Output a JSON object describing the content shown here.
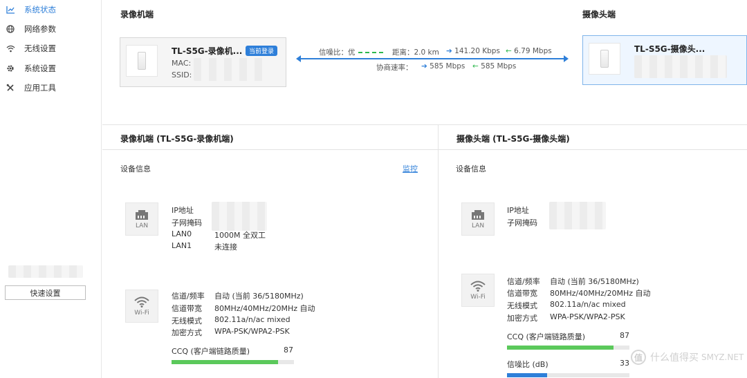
{
  "sidebar": {
    "items": [
      {
        "label": "系统状态",
        "icon": "chart-icon",
        "active": true
      },
      {
        "label": "网络参数",
        "icon": "globe-icon",
        "active": false
      },
      {
        "label": "无线设置",
        "icon": "wifi-icon",
        "active": false
      },
      {
        "label": "系统设置",
        "icon": "gear-icon",
        "active": false
      },
      {
        "label": "应用工具",
        "icon": "tools-icon",
        "active": false
      }
    ],
    "quick_setup": "快速设置"
  },
  "top": {
    "recorder_title": "录像机端",
    "camera_title": "摄像头端",
    "recorder_card": {
      "name": "TL-S5G-录像机...",
      "badge": "当前登录",
      "mac_label": "MAC:",
      "ssid_label": "SSID:"
    },
    "camera_card": {
      "name": "TL-S5G-摄像头..."
    },
    "link": {
      "snr_label": "信噪比：优",
      "distance_label": "距离：2.0 km",
      "tx_rate": "141.20 Kbps",
      "rx_rate": "6.79 Mbps",
      "negotiate_label": "协商速率：",
      "negotiate_tx": "585 Mbps",
      "negotiate_rx": "585 Mbps"
    }
  },
  "left_panel": {
    "title": "录像机端 (TL-S5G-录像机端)",
    "device_info": "设备信息",
    "monitor": "监控",
    "lan": {
      "tile_label": "LAN",
      "rows": [
        {
          "label": "IP地址",
          "value": ""
        },
        {
          "label": "子网掩码",
          "value": ""
        },
        {
          "label": "LAN0",
          "value": "1000M 全双工"
        },
        {
          "label": "LAN1",
          "value": "未连接"
        }
      ]
    },
    "wifi": {
      "tile_label": "Wi-Fi",
      "rows": [
        {
          "label": "信道/频率",
          "value": "自动 (当前 36/5180MHz)"
        },
        {
          "label": "信道带宽",
          "value": "80MHz/40MHz/20MHz 自动"
        },
        {
          "label": "无线模式",
          "value": "802.11a/n/ac mixed"
        },
        {
          "label": "加密方式",
          "value": "WPA-PSK/WPA2-PSK"
        }
      ]
    },
    "ccq": {
      "label": "CCQ (客户端链路质量)",
      "value": "87",
      "percent": 87
    }
  },
  "right_panel": {
    "title": "摄像头端 (TL-S5G-摄像头端)",
    "device_info": "设备信息",
    "lan": {
      "tile_label": "LAN",
      "rows": [
        {
          "label": "IP地址",
          "value": ""
        },
        {
          "label": "子网掩码",
          "value": ""
        }
      ]
    },
    "wifi": {
      "tile_label": "Wi-Fi",
      "rows": [
        {
          "label": "信道/频率",
          "value": "自动 (当前 36/5180MHz)"
        },
        {
          "label": "信道带宽",
          "value": "80MHz/40MHz/20MHz 自动"
        },
        {
          "label": "无线模式",
          "value": "802.11a/n/ac mixed"
        },
        {
          "label": "加密方式",
          "value": "WPA-PSK/WPA2-PSK"
        }
      ]
    },
    "ccq": {
      "label": "CCQ (客户端链路质量)",
      "value": "87",
      "percent": 87
    },
    "snr": {
      "label": "信噪比 (dB)",
      "value": "33",
      "percent": 33
    }
  },
  "watermark": {
    "icon_char": "值",
    "text": "什么值得买",
    "brand": "SMYZ.NET"
  },
  "colors": {
    "accent": "#2e7fd9",
    "green": "#5bc95b",
    "blue_bar": "#2e7fd9"
  }
}
